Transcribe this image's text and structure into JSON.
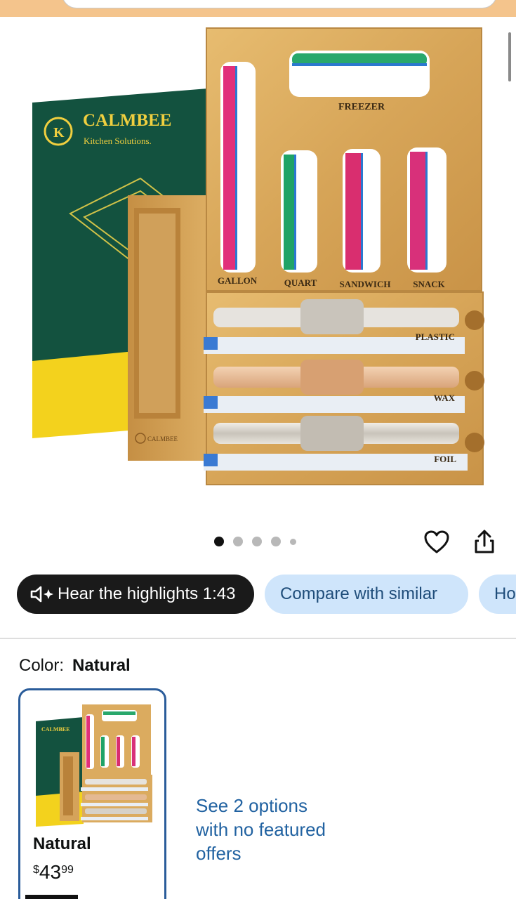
{
  "product_image": {
    "brand": "CALMBEE",
    "tagline": "Kitchen Solutions.",
    "compartments": [
      "FREEZER",
      "GALLON",
      "QUART",
      "SANDWICH",
      "SNACK"
    ],
    "rolls": [
      "PLASTIC",
      "WAX",
      "FOIL"
    ]
  },
  "carousel": {
    "total": 5,
    "active": 1
  },
  "icons": {
    "favorite": "heart-icon",
    "share": "share-icon",
    "speaker": "speaker-sparkle-icon"
  },
  "chips": {
    "highlights_label": "Hear the highlights 1:43",
    "compare_label": "Compare with similar",
    "next_label": "Ho"
  },
  "color": {
    "label": "Color:",
    "value": "Natural"
  },
  "swatch": {
    "name": "Natural",
    "price_currency": "$",
    "price_whole": "43",
    "price_cents": "99"
  },
  "options_link": "See 2 options with no featured offers",
  "colors": {
    "accent_blue": "#2162a1",
    "chip_light": "#cfe5fb",
    "chip_dark": "#1a1a1a",
    "bamboo": "#d9a95a",
    "box_green": "#13523f",
    "box_yellow": "#f3d21d"
  }
}
